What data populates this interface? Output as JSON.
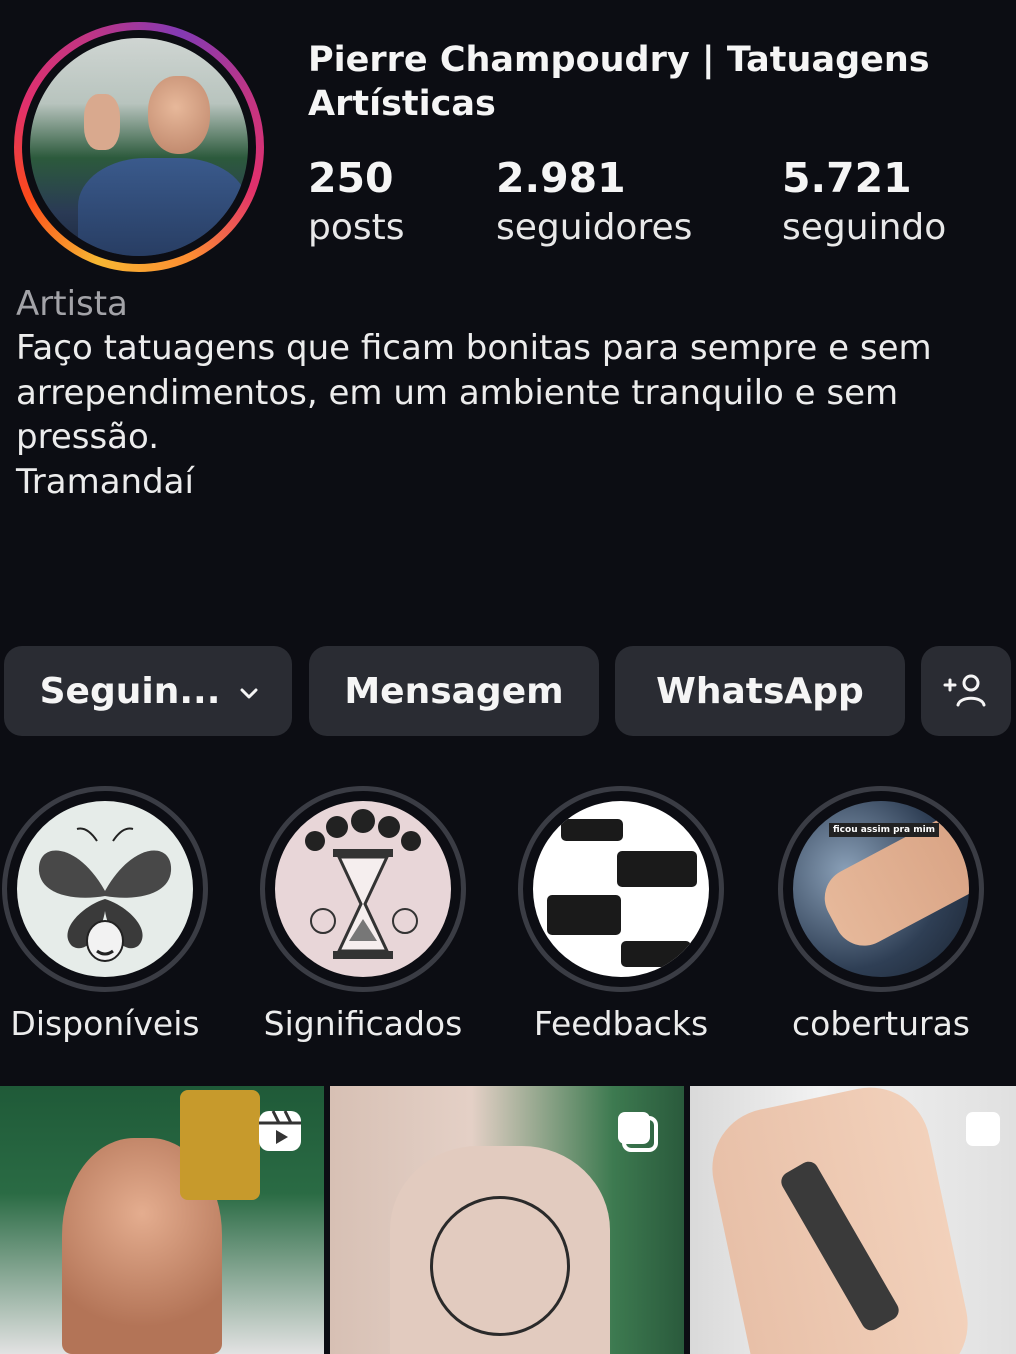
{
  "profile": {
    "name": "Pierre Champoudry | Tatuagens Artísticas",
    "stats": [
      {
        "value": "250",
        "label": "posts"
      },
      {
        "value": "2.981",
        "label": "seguidores"
      },
      {
        "value": "5.721",
        "label": "seguindo"
      }
    ],
    "category": "Artista",
    "bio": "Faço tatuagens que ficam bonitas para sempre e sem arrependimentos, em um ambiente tranquilo e sem pressão.",
    "location": "Tramandaí"
  },
  "actions": {
    "following_label": "Seguin...",
    "message_label": "Mensagem",
    "whatsapp_label": "WhatsApp",
    "suggest_icon": "add-person-icon"
  },
  "highlights": [
    {
      "label": "Disponíveis"
    },
    {
      "label": "Significados"
    },
    {
      "label": "Feedbacks"
    },
    {
      "label": "coberturas"
    }
  ],
  "highlight_texts": {
    "coberturas_caption": "ficou assim pra mim"
  },
  "grid_icons": [
    "reels-icon",
    "carousel-icon",
    "carousel-icon"
  ],
  "colors": {
    "background": "#0c0d13",
    "button": "#2a2c33",
    "secondary_text": "#a3a3a8"
  }
}
